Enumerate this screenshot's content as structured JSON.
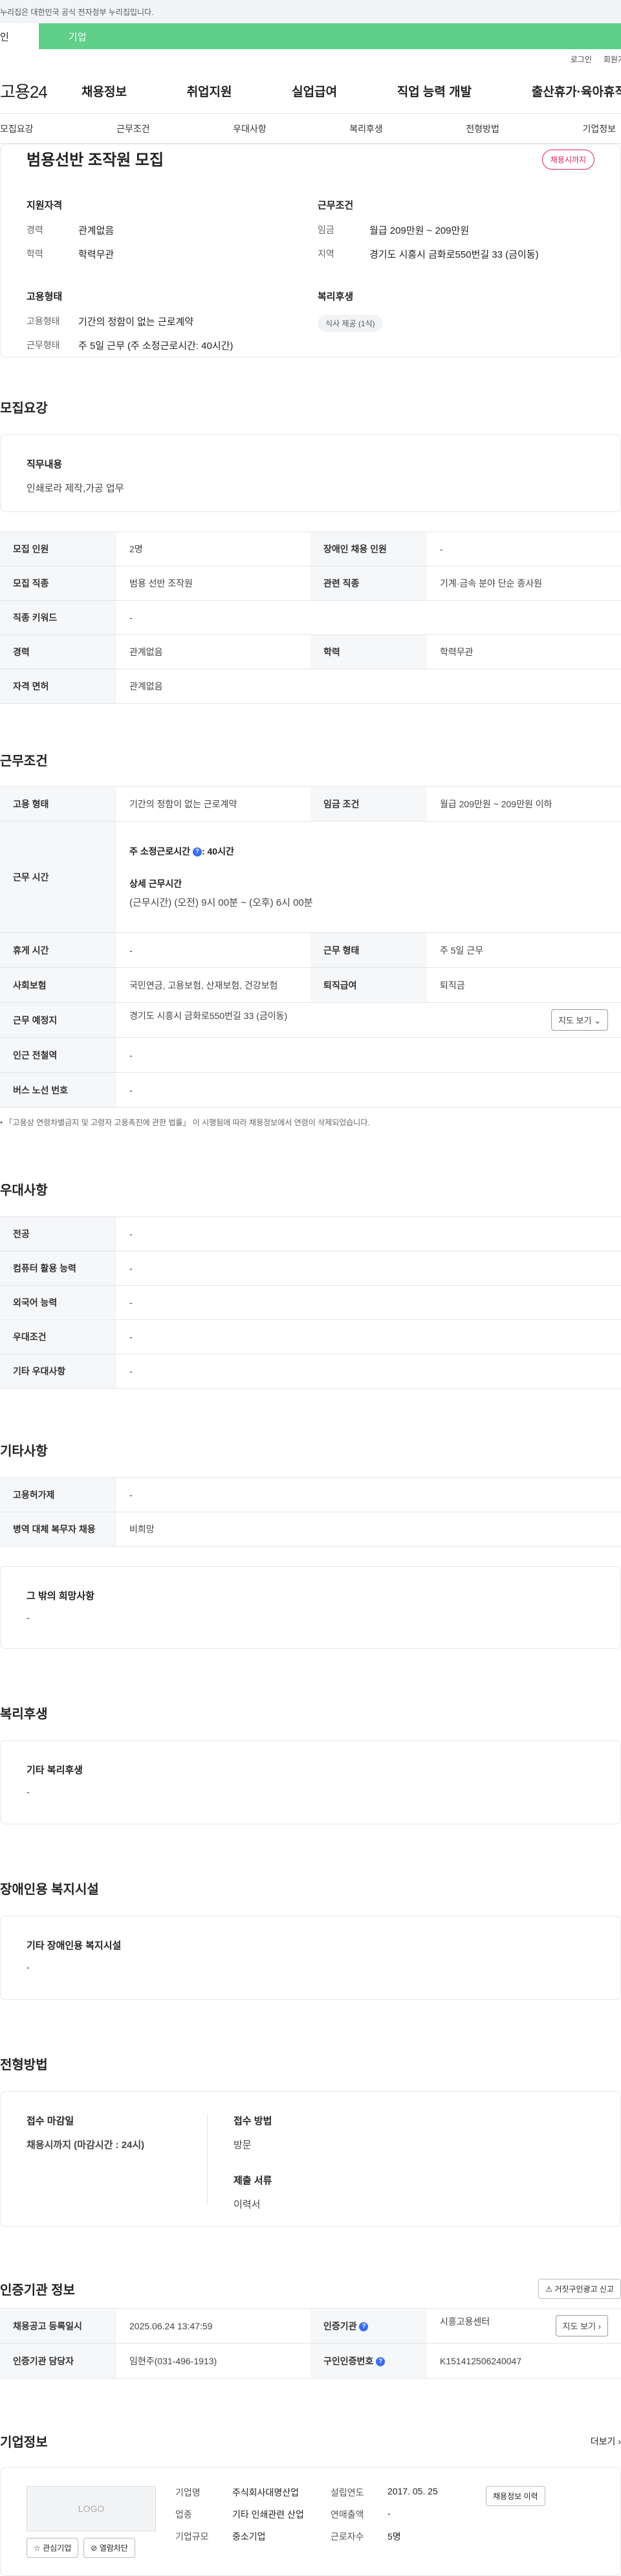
{
  "gov_bar": "누리집은 대한민국 공식 전자정부 누리집입니다.",
  "type_tabs": {
    "individual": "인",
    "company": "기업"
  },
  "util": {
    "login": "로그인",
    "join": "회원가"
  },
  "gnb": {
    "logo": "고용24",
    "menu": [
      "채용정보",
      "취업지원",
      "실업급여",
      "직업 능력 개발",
      "출산휴가·육아휴직"
    ]
  },
  "tabs": [
    "모집요강",
    "근무조건",
    "우대사항",
    "복리후생",
    "전형방법",
    "기업정보"
  ],
  "top": {
    "title": "범용선반 조작원 모집",
    "badge": "채용시까지",
    "qual_title": "지원자격",
    "qual": [
      {
        "k": "경력",
        "v": "관계없음"
      },
      {
        "k": "학력",
        "v": "학력무관"
      }
    ],
    "cond_title": "근무조건",
    "cond": [
      {
        "k": "임금",
        "v": "월급 209만원 ~ 209만원"
      },
      {
        "k": "지역",
        "v": "경기도 시흥시 금화로550번길 33 (금이동)"
      }
    ],
    "emp_title": "고용형태",
    "emp": [
      {
        "k": "고용형태",
        "v": "기간의 정함이 없는 근로계약"
      },
      {
        "k": "근무형태",
        "v": "주 5일 근무 (주 소정근로시간: 40시간)"
      }
    ],
    "welfare_title": "복리후생",
    "welfare_pill": "식사 제공 (1식)"
  },
  "recruit": {
    "title": "모집요강",
    "duty_h": "직무내용",
    "duty_v": "인쇄로라 제작,가공 업무",
    "rows": [
      {
        "k1": "모집 인원",
        "v1": "2명",
        "k2": "장애인 채용 인원",
        "v2": "-"
      },
      {
        "k1": "모집 직종",
        "v1": "범용 선반 조작원",
        "k2": "관련 직종",
        "v2": "기계·금속 분야 단순 종사원"
      },
      {
        "k1": "직종 키워드",
        "v1": "-"
      },
      {
        "k1": "경력",
        "v1": "관계없음",
        "k2": "학력",
        "v2": "학력무관"
      },
      {
        "k1": "자격 면허",
        "v1": "관계없음"
      }
    ]
  },
  "work": {
    "title": "근무조건",
    "emp_k": "고용 형태",
    "emp_v": "기간의 정함이 없는 근로계약",
    "wage_k": "임금 조건",
    "wage_v": "월급 209만원 ~ 209만원 이하",
    "hours_k": "근무 시간",
    "hours_l1": "주 소정근로시간",
    "hours_l1b": ": 40시간",
    "hours_l2": "상세 근무시간",
    "hours_l3": "(근무시간) (오전) 9시 00분 ~ (오후) 6시 00분",
    "rest_k": "휴게 시간",
    "rest_v": "-",
    "type_k": "근무 형태",
    "type_v": "주 5일 근무",
    "ins_k": "사회보험",
    "ins_v": "국민연금, 고용보험, 산재보험, 건강보험",
    "ret_k": "퇴직급여",
    "ret_v": "퇴직금",
    "loc_k": "근무 예정지",
    "loc_v": "경기도 시흥시 금화로550번길 33 (금이동)",
    "map_btn": "지도 보기",
    "subway_k": "인근 전철역",
    "subway_v": "-",
    "bus_k": "버스 노선 번호",
    "bus_v": "-",
    "note": "「고용상 연령차별금지 및 고령자 고용촉진에 관한 법률」 이 시행됨에 따라 채용정보에서 연령이 삭제되었습니다."
  },
  "pref": {
    "title": "우대사항",
    "rows": [
      {
        "k": "전공",
        "v": "-"
      },
      {
        "k": "컴퓨터 활용 능력",
        "v": "-"
      },
      {
        "k": "외국어 능력",
        "v": "-"
      },
      {
        "k": "우대조건",
        "v": "-"
      },
      {
        "k": "기타 우대사항",
        "v": "-"
      }
    ]
  },
  "etc": {
    "title": "기타사항",
    "rows": [
      {
        "k": "고용허가제",
        "v": "-"
      },
      {
        "k": "병역 대체 복무자 채용",
        "v": "비희망"
      }
    ],
    "box_h": "그 밖의 희망사항",
    "box_v": "-"
  },
  "benefit": {
    "title": "복리후생",
    "box_h": "기타 복리후생",
    "box_v": "-"
  },
  "disabled": {
    "title": "장애인용 복지시설",
    "box_h": "기타 장애인용 복지시설",
    "box_v": "-"
  },
  "process": {
    "title": "전형방법",
    "deadline_h": "접수 마감일",
    "deadline_v": "채용시까지 (마감시간 : 24시)",
    "method_h": "접수 방법",
    "method_v": "방문",
    "docs_h": "제출 서류",
    "docs_v": "이력서"
  },
  "cert": {
    "title": "인증기관 정보",
    "report_btn": "거짓구인광고 신고",
    "reg_k": "채용공고 등록일시",
    "reg_v": "2025.06.24 13:47:59",
    "org_k": "인증기관",
    "org_v": "시흥고용센터",
    "map_btn": "지도 보기",
    "mgr_k": "인증기관 담당자",
    "mgr_v": "임현주(031-496-1913)",
    "no_k": "구인인증번호",
    "no_v": "K151412506240047"
  },
  "company": {
    "title": "기업정보",
    "more": "더보기",
    "logo": "LOGO",
    "fav_btn": "관심기업",
    "block_btn": "열람차단",
    "name_k": "기업명",
    "name_v": "주식회사대명산업",
    "ind_k": "업종",
    "ind_v": "기타 인쇄관련 산업",
    "size_k": "기업규모",
    "size_v": "중소기업",
    "est_k": "설립연도",
    "est_v": "2017. 05. 25",
    "sales_k": "연매출액",
    "sales_v": "-",
    "emp_k": "근로자수",
    "emp_v": "5명",
    "history_btn": "채용정보 이력"
  }
}
